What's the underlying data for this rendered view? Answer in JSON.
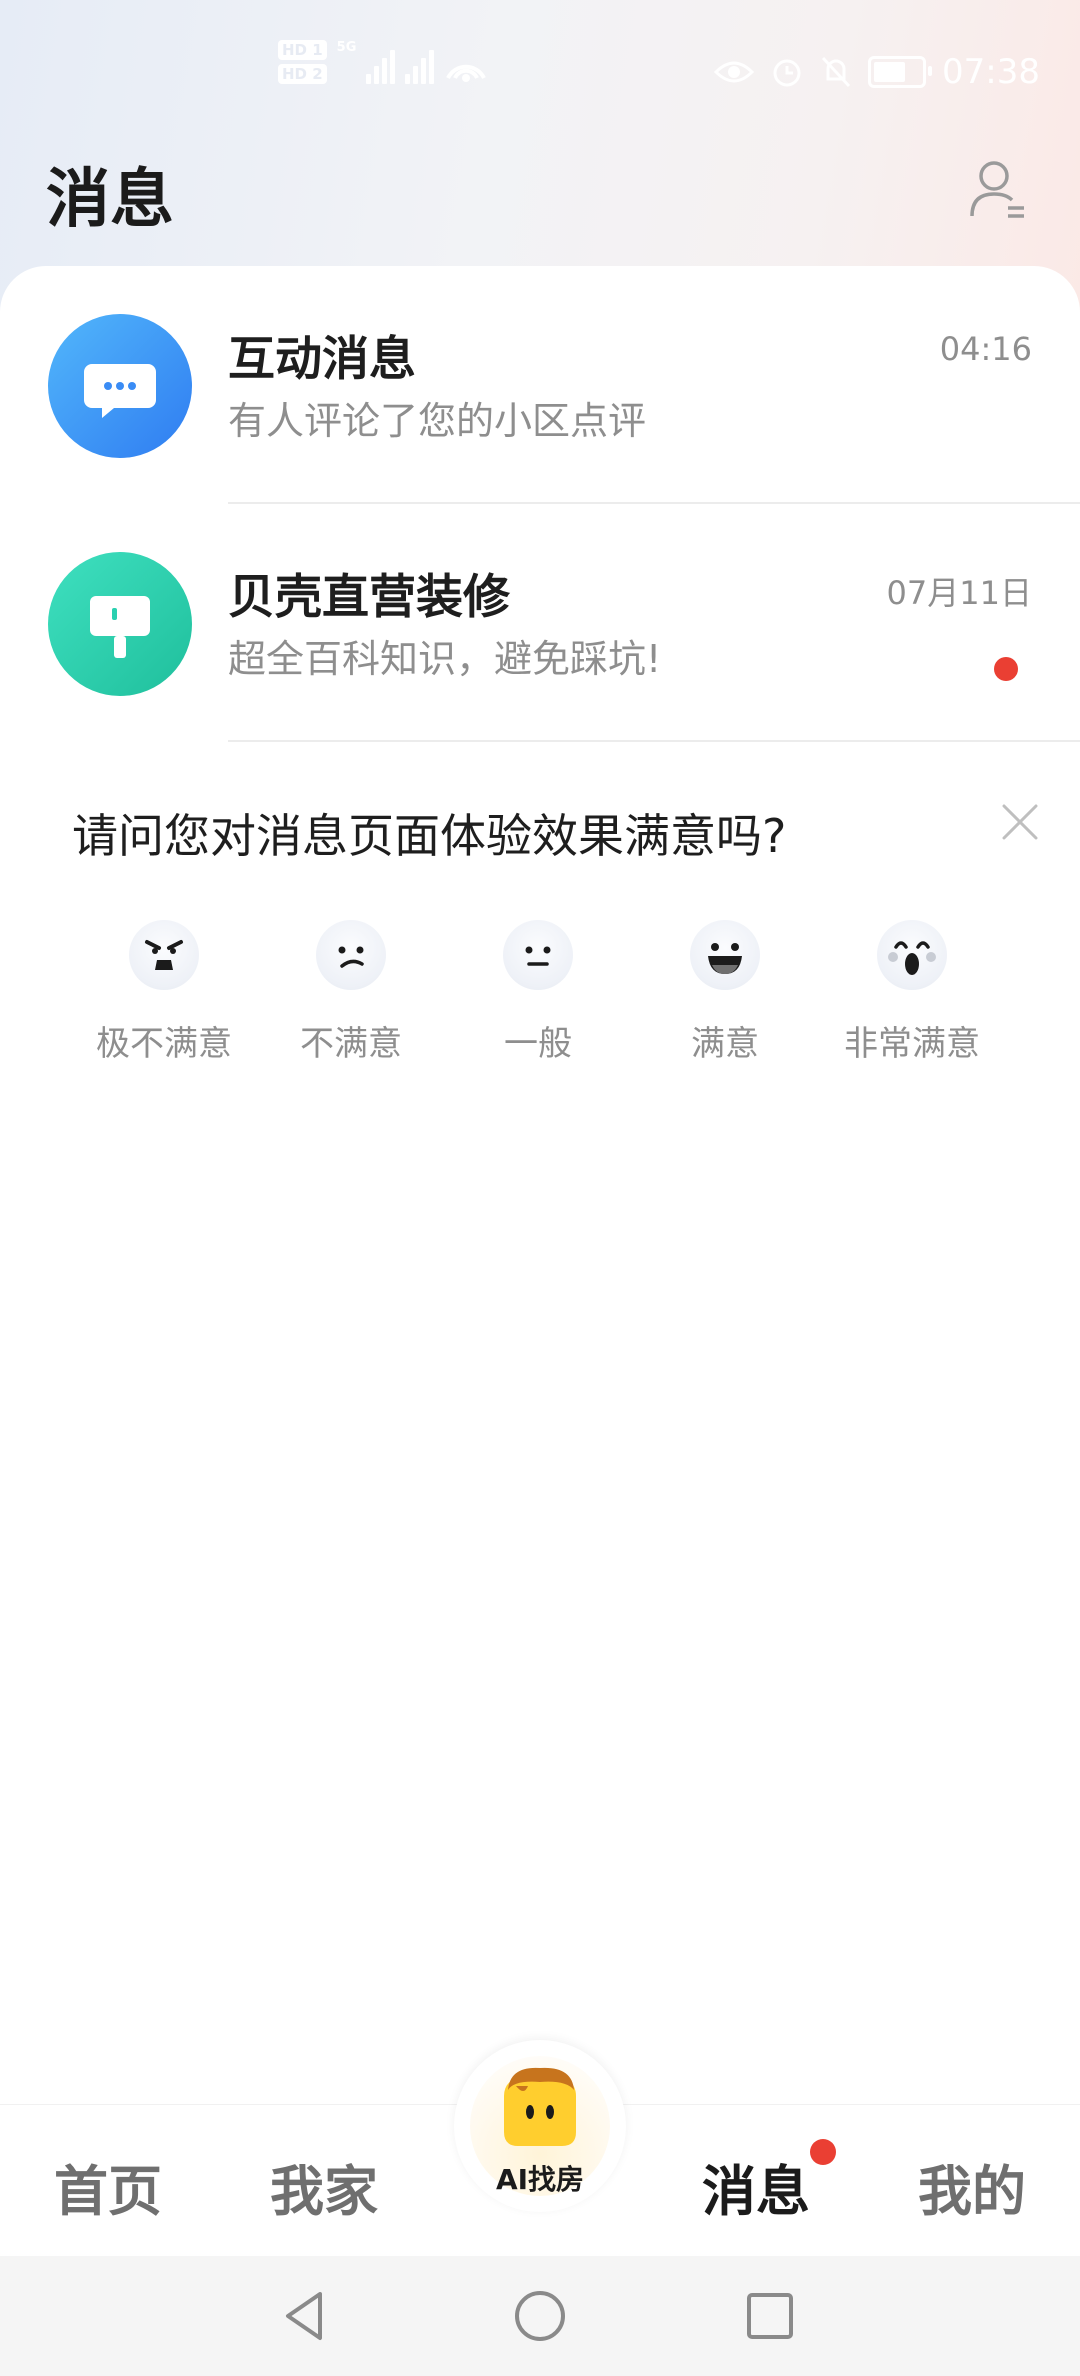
{
  "status_bar": {
    "time": "07:38",
    "sim1": "HD 1",
    "sim2": "HD 2",
    "network_label": "5G",
    "icons": [
      "eye-icon",
      "alarm-icon",
      "mute-icon",
      "battery-icon"
    ]
  },
  "header": {
    "title": "消息",
    "profile_icon": "user-icon"
  },
  "messages": [
    {
      "name": "互动消息",
      "preview": "有人评论了您的小区点评",
      "time": "04:16",
      "icon": "chat-bubble-icon",
      "unread": false
    },
    {
      "name": "贝壳直营装修",
      "preview": "超全百科知识，避免踩坑!",
      "time": "07月11日",
      "icon": "paint-roller-icon",
      "unread": true
    }
  ],
  "survey": {
    "question": "请问您对消息页面体验效果满意吗?",
    "options": [
      {
        "label": "极不满意",
        "icon": "very-angry-face-icon"
      },
      {
        "label": "不满意",
        "icon": "unhappy-face-icon"
      },
      {
        "label": "一般",
        "icon": "neutral-face-icon"
      },
      {
        "label": "满意",
        "icon": "happy-face-icon"
      },
      {
        "label": "非常满意",
        "icon": "amazed-face-icon"
      }
    ]
  },
  "bottom_nav": {
    "items": [
      {
        "label": "首页"
      },
      {
        "label": "我家"
      },
      {
        "label": "AI找房"
      },
      {
        "label": "消息",
        "active": true,
        "badge": true
      },
      {
        "label": "我的"
      }
    ]
  },
  "colors": {
    "accent_red": "#ea3f33",
    "chat_blue": "#3a8cf5",
    "renovation_green": "#2ad0b0"
  }
}
